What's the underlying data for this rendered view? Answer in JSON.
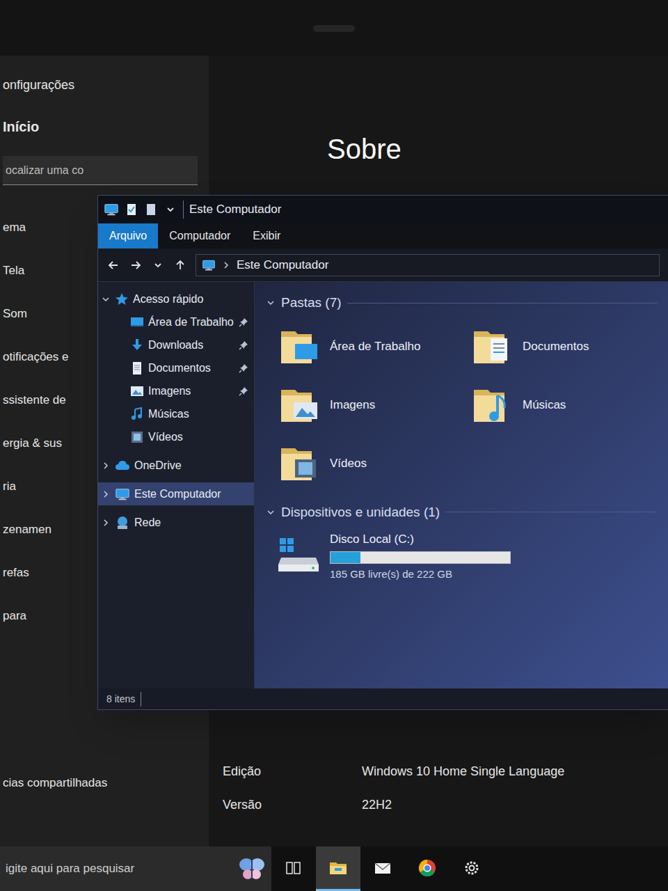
{
  "settings": {
    "title": "onfigurações",
    "home": "Início",
    "search": {
      "placeholder": "ocalizar uma co"
    },
    "items": [
      "ema",
      "Tela",
      "Som",
      "otificações e",
      "ssistente de",
      "ergia & sus",
      "ria",
      "zenamen",
      "refas",
      "para",
      "cias compartilhadas"
    ],
    "heading": "Sobre",
    "specs": [
      {
        "label": "Edição",
        "value": "Windows 10 Home Single Language"
      },
      {
        "label": "Versão",
        "value": "22H2"
      }
    ]
  },
  "explorer": {
    "title": "Este Computador",
    "tabs": [
      {
        "label": "Arquivo",
        "selected": true
      },
      {
        "label": "Computador",
        "selected": false
      },
      {
        "label": "Exibir",
        "selected": false
      }
    ],
    "address": "Este Computador",
    "nav": [
      {
        "label": "Acesso rápido",
        "expanded": true,
        "selected": false,
        "children": [
          {
            "label": "Área de Trabalho",
            "pinned": true
          },
          {
            "label": "Downloads",
            "pinned": true
          },
          {
            "label": "Documentos",
            "pinned": true
          },
          {
            "label": "Imagens",
            "pinned": true
          },
          {
            "label": "Músicas",
            "pinned": false
          },
          {
            "label": "Vídeos",
            "pinned": false
          }
        ]
      },
      {
        "label": "OneDrive",
        "expanded": false,
        "selected": false,
        "children": []
      },
      {
        "label": "Este Computador",
        "expanded": false,
        "selected": true,
        "children": []
      },
      {
        "label": "Rede",
        "expanded": false,
        "selected": false,
        "children": []
      }
    ],
    "folders_group": {
      "title": "Pastas (7)",
      "expanded": true,
      "items": [
        "Área de Trabalho",
        "Documentos",
        "Imagens",
        "Músicas",
        "Vídeos"
      ]
    },
    "drives_group": {
      "title": "Dispositivos e unidades (1)",
      "expanded": true,
      "drives": [
        {
          "name": "Disco Local (C:)",
          "level": 0.167,
          "free_text": "185 GB livre(s) de 222 GB"
        }
      ]
    },
    "status_bar": {
      "count": "8 itens"
    }
  },
  "taskbar": {
    "search": {
      "placeholder": "igite aqui para pesquisar"
    },
    "apps": [
      {
        "active": false
      },
      {
        "active": true
      },
      {
        "active": false
      },
      {
        "active": false
      },
      {
        "active": false
      }
    ]
  }
}
